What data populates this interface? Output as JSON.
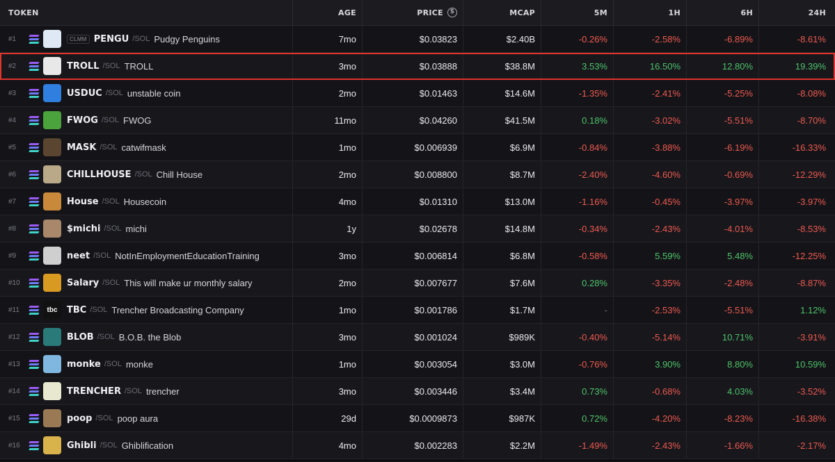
{
  "header": {
    "token": "TOKEN",
    "age": "AGE",
    "price": "PRICE",
    "price_icon": "$",
    "mcap": "MCAP",
    "m5": "5M",
    "h1": "1H",
    "h6": "6H",
    "h24": "24H"
  },
  "colors": {
    "positive": "#4fc36b",
    "negative": "#ef5a51",
    "highlight": "#e0342c"
  },
  "rows": [
    {
      "rank": "#1",
      "badge": "CLMM",
      "symbol": "PENGU",
      "chain": "SOL",
      "name": "Pudgy Penguins",
      "age": "7mo",
      "price": "$0.03823",
      "mcap": "$2.40B",
      "m5": "-0.26%",
      "h1": "-2.58%",
      "h6": "-6.89%",
      "h24": "-8.61%",
      "avatar_color": "#dfe8f5",
      "avatar_icon": "penguin-icon"
    },
    {
      "rank": "#2",
      "badge": "",
      "symbol": "TROLL",
      "chain": "SOL",
      "name": "TROLL",
      "age": "3mo",
      "price": "$0.03888",
      "mcap": "$38.8M",
      "m5": "3.53%",
      "h1": "16.50%",
      "h6": "12.80%",
      "h24": "19.39%",
      "avatar_color": "#e8e8e8",
      "avatar_icon": "trollface-icon",
      "highlighted": true
    },
    {
      "rank": "#3",
      "badge": "",
      "symbol": "USDUC",
      "chain": "SOL",
      "name": "unstable coin",
      "age": "2mo",
      "price": "$0.01463",
      "mcap": "$14.6M",
      "m5": "-1.35%",
      "h1": "-2.41%",
      "h6": "-5.25%",
      "h24": "-8.08%",
      "avatar_color": "#2f7fe0",
      "avatar_icon": "wave-icon"
    },
    {
      "rank": "#4",
      "badge": "",
      "symbol": "FWOG",
      "chain": "SOL",
      "name": "FWOG",
      "age": "11mo",
      "price": "$0.04260",
      "mcap": "$41.5M",
      "m5": "0.18%",
      "h1": "-3.02%",
      "h6": "-5.51%",
      "h24": "-8.70%",
      "avatar_color": "#4aa33c",
      "avatar_icon": "frog-icon"
    },
    {
      "rank": "#5",
      "badge": "",
      "symbol": "MASK",
      "chain": "SOL",
      "name": "catwifmask",
      "age": "1mo",
      "price": "$0.006939",
      "mcap": "$6.9M",
      "m5": "-0.84%",
      "h1": "-3.88%",
      "h6": "-6.19%",
      "h24": "-16.33%",
      "avatar_color": "#5a4630",
      "avatar_icon": "cat-icon"
    },
    {
      "rank": "#6",
      "badge": "",
      "symbol": "CHILLHOUSE",
      "chain": "SOL",
      "name": "Chill House",
      "age": "2mo",
      "price": "$0.008800",
      "mcap": "$8.7M",
      "m5": "-2.40%",
      "h1": "-4.60%",
      "h6": "-0.69%",
      "h24": "-12.29%",
      "avatar_color": "#b9a988",
      "avatar_icon": "house-icon"
    },
    {
      "rank": "#7",
      "badge": "",
      "symbol": "House",
      "chain": "SOL",
      "name": "Housecoin",
      "age": "4mo",
      "price": "$0.01310",
      "mcap": "$13.0M",
      "m5": "-1.16%",
      "h1": "-0.45%",
      "h6": "-3.97%",
      "h24": "-3.97%",
      "avatar_color": "#c9893a",
      "avatar_icon": "house-coin-icon"
    },
    {
      "rank": "#8",
      "badge": "",
      "symbol": "$michi",
      "chain": "SOL",
      "name": "michi",
      "age": "1y",
      "price": "$0.02678",
      "mcap": "$14.8M",
      "m5": "-0.34%",
      "h1": "-2.43%",
      "h6": "-4.01%",
      "h24": "-8.53%",
      "avatar_color": "#a8876a",
      "avatar_icon": "cat-icon"
    },
    {
      "rank": "#9",
      "badge": "",
      "symbol": "neet",
      "chain": "SOL",
      "name": "NotInEmploymentEducationTraining",
      "age": "3mo",
      "price": "$0.006814",
      "mcap": "$6.8M",
      "m5": "-0.58%",
      "h1": "5.59%",
      "h6": "5.48%",
      "h24": "-12.25%",
      "avatar_color": "#cfcfcf",
      "avatar_icon": "face-icon"
    },
    {
      "rank": "#10",
      "badge": "",
      "symbol": "Salary",
      "chain": "SOL",
      "name": "This will make ur monthly salary",
      "age": "2mo",
      "price": "$0.007677",
      "mcap": "$7.6M",
      "m5": "0.28%",
      "h1": "-3.35%",
      "h6": "-2.48%",
      "h24": "-8.87%",
      "avatar_color": "#d99a22",
      "avatar_icon": "coin-icon"
    },
    {
      "rank": "#11",
      "badge": "",
      "symbol": "TBC",
      "chain": "SOL",
      "name": "Trencher Broadcasting Company",
      "age": "1mo",
      "price": "$0.001786",
      "mcap": "$1.7M",
      "m5": "-",
      "h1": "-2.53%",
      "h6": "-5.51%",
      "h24": "1.12%",
      "avatar_color": "#111111",
      "avatar_icon": "tbc-logo-icon",
      "avatar_text": "tbc"
    },
    {
      "rank": "#12",
      "badge": "",
      "symbol": "BLOB",
      "chain": "SOL",
      "name": "B.O.B. the Blob",
      "age": "3mo",
      "price": "$0.001024",
      "mcap": "$989K",
      "m5": "-0.40%",
      "h1": "-5.14%",
      "h6": "10.71%",
      "h24": "-3.91%",
      "avatar_color": "#2a7a7a",
      "avatar_icon": "blob-icon"
    },
    {
      "rank": "#13",
      "badge": "",
      "symbol": "monke",
      "chain": "SOL",
      "name": "monke",
      "age": "1mo",
      "price": "$0.003054",
      "mcap": "$3.0M",
      "m5": "-0.76%",
      "h1": "3.90%",
      "h6": "8.80%",
      "h24": "10.59%",
      "avatar_color": "#7fb7e0",
      "avatar_icon": "monkey-icon"
    },
    {
      "rank": "#14",
      "badge": "",
      "symbol": "TRENCHER",
      "chain": "SOL",
      "name": "trencher",
      "age": "3mo",
      "price": "$0.003446",
      "mcap": "$3.4M",
      "m5": "0.73%",
      "h1": "-0.68%",
      "h6": "4.03%",
      "h24": "-3.52%",
      "avatar_color": "#e8e8d0",
      "avatar_icon": "cartoon-icon"
    },
    {
      "rank": "#15",
      "badge": "",
      "symbol": "poop",
      "chain": "SOL",
      "name": "poop aura",
      "age": "29d",
      "price": "$0.0009873",
      "mcap": "$987K",
      "m5": "0.72%",
      "h1": "-4.20%",
      "h6": "-8.23%",
      "h24": "-16.38%",
      "avatar_color": "#9a7a55",
      "avatar_icon": "poop-icon"
    },
    {
      "rank": "#16",
      "badge": "",
      "symbol": "Ghibli",
      "chain": "SOL",
      "name": "Ghiblification",
      "age": "4mo",
      "price": "$0.002283",
      "mcap": "$2.2M",
      "m5": "-1.49%",
      "h1": "-2.43%",
      "h6": "-1.66%",
      "h24": "-2.17%",
      "avatar_color": "#d8b24a",
      "avatar_icon": "ghibli-icon"
    }
  ]
}
